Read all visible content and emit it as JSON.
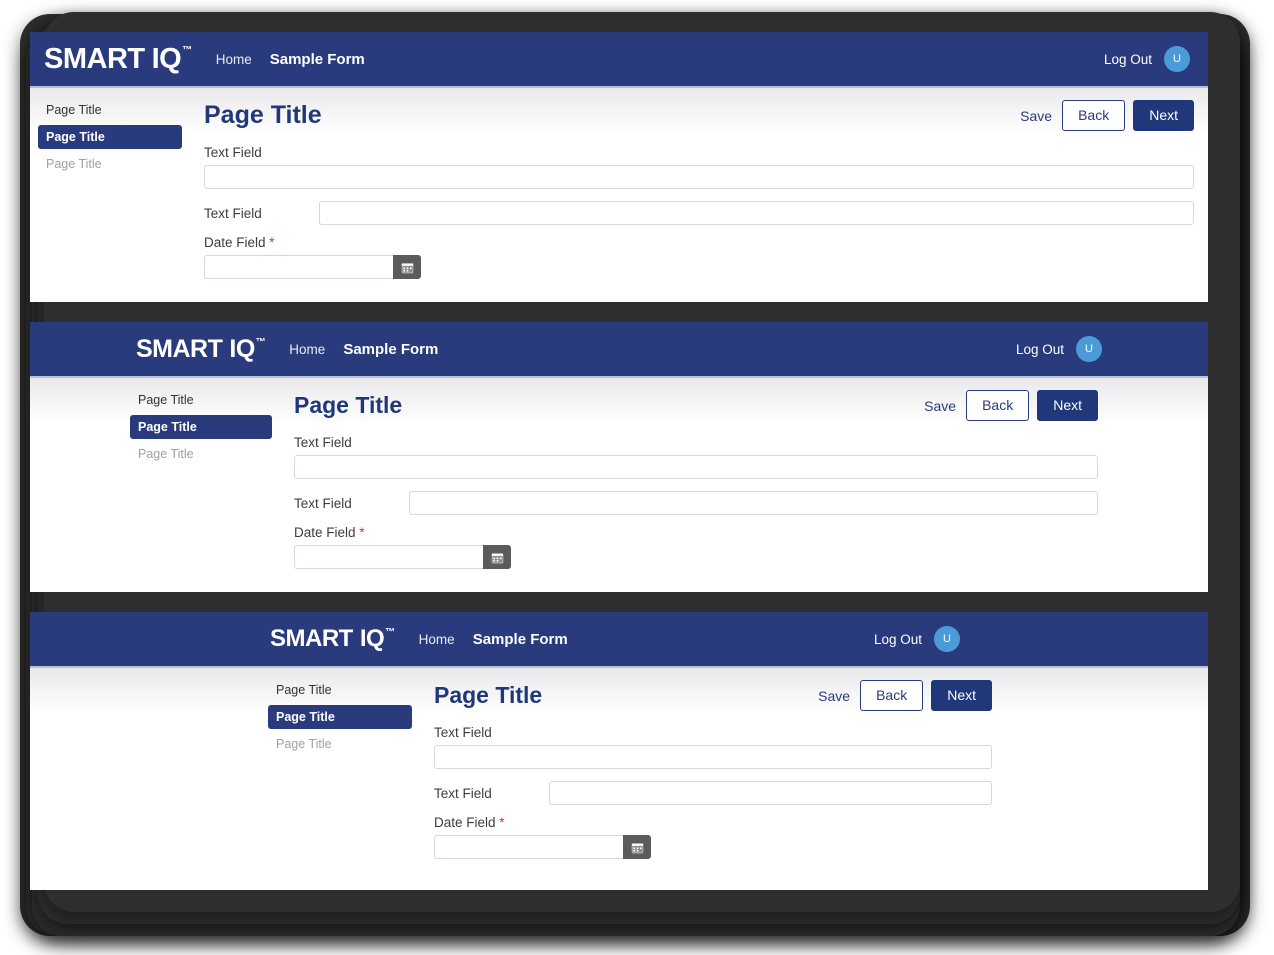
{
  "brand": {
    "word1": "SMART",
    "word2": "IQ",
    "tm": "™"
  },
  "nav": {
    "home_label": "Home",
    "form_label": "Sample Form",
    "logout_label": "Log Out",
    "avatar_initial": "U"
  },
  "sidebar": {
    "items": [
      {
        "label": "Page Title",
        "state": "default"
      },
      {
        "label": "Page Title",
        "state": "active"
      },
      {
        "label": "Page Title",
        "state": "muted"
      }
    ]
  },
  "content": {
    "page_title": "Page Title",
    "save_label": "Save",
    "back_label": "Back",
    "next_label": "Next"
  },
  "form": {
    "text_field_1": {
      "label": "Text Field",
      "value": "",
      "placeholder": ""
    },
    "text_field_2": {
      "label": "Text Field",
      "value": "",
      "placeholder": ""
    },
    "date_field": {
      "label": "Date Field",
      "required_marker": "*",
      "value": "",
      "placeholder": ""
    }
  },
  "colors": {
    "navy": "#2a3b7d",
    "navy_dark": "#20377a",
    "avatar_blue": "#4a9bd8",
    "required_red": "#d0342c",
    "frame_dark": "#2e2e2e",
    "calendar_btn_gray": "#5b5b5b"
  },
  "icons": {
    "calendar": "calendar-icon"
  },
  "panels": [
    {
      "id": "panel-1",
      "scale": "large"
    },
    {
      "id": "panel-2",
      "scale": "medium"
    },
    {
      "id": "panel-3",
      "scale": "small"
    }
  ]
}
